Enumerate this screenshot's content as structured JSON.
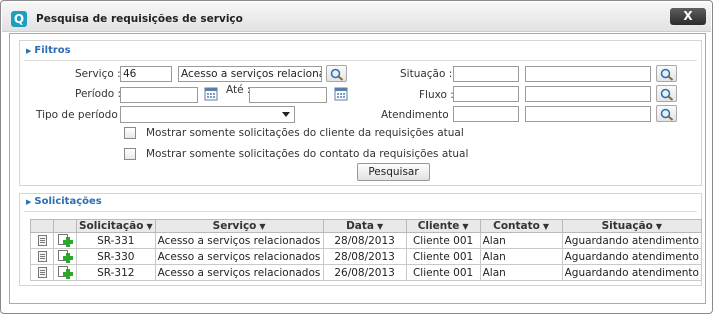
{
  "window": {
    "title": "Pesquisa de requisições de serviço",
    "close_label": "X",
    "app_icon_letter": "Q"
  },
  "filtros": {
    "header": "Filtros",
    "servico_label": "Serviço :",
    "servico_code": "46",
    "servico_name": "Acesso a serviços relaciona",
    "periodo_label": "Período :",
    "periodo_start": "",
    "ate_label": "Até :",
    "periodo_end": "",
    "tipo_periodo_label": "Tipo de período :",
    "tipo_periodo_value": "",
    "situacao_label": "Situação :",
    "situacao_code": "",
    "situacao_name": "",
    "fluxo_label": "Fluxo :",
    "fluxo_code": "",
    "fluxo_name": "",
    "atendimento_label": "Atendimento :",
    "atendimento_code": "",
    "atendimento_name": "",
    "chk_cliente_label": "Mostrar somente solicitações do cliente da requisições atual",
    "chk_contato_label": "Mostrar somente solicitações do contato da requisições atual",
    "pesquisar_label": "Pesquisar"
  },
  "solicitacoes": {
    "header": "Solicitações",
    "columns": [
      "Solicitação",
      "Serviço",
      "Data",
      "Cliente",
      "Contato",
      "Situação"
    ],
    "rows": [
      {
        "solicitacao": "SR-331",
        "servico": "Acesso a serviços relacionados",
        "data": "28/08/2013",
        "cliente": "Cliente 001",
        "contato": "Alan",
        "situacao": "Aguardando atendimento"
      },
      {
        "solicitacao": "SR-330",
        "servico": "Acesso a serviços relacionados",
        "data": "28/08/2013",
        "cliente": "Cliente 001",
        "contato": "Alan",
        "situacao": "Aguardando atendimento"
      },
      {
        "solicitacao": "SR-312",
        "servico": "Acesso a serviços relacionados",
        "data": "26/08/2013",
        "cliente": "Cliente 001",
        "contato": "Alan",
        "situacao": "Aguardando atendimento"
      }
    ]
  },
  "colors": {
    "accent": "#2a6db5",
    "close_bg": "#3a3a3a",
    "add_green": "#2aa82a"
  }
}
